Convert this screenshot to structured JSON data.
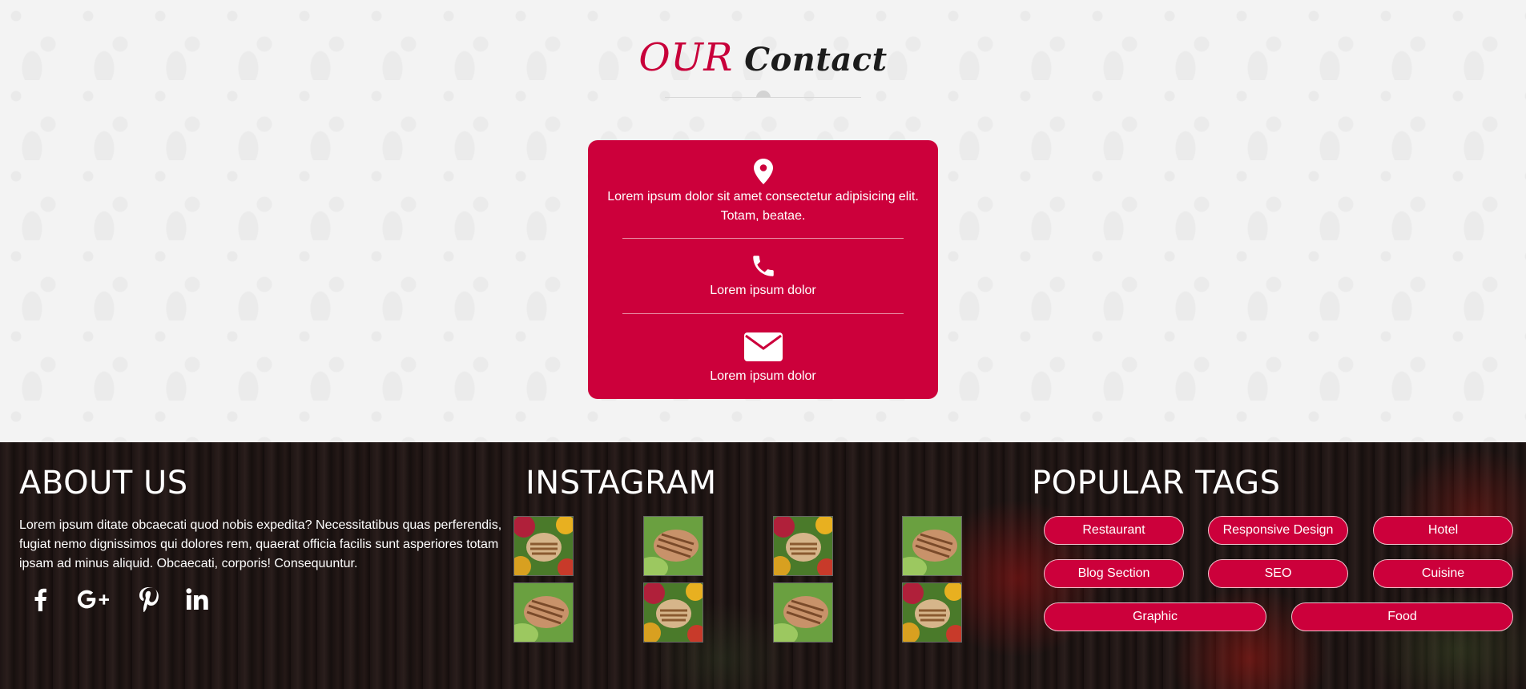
{
  "contact": {
    "title_accent": "OUR",
    "title_rest": "Contact",
    "address": "Lorem ipsum dolor sit amet consectetur adipisicing elit. Totam, beatae.",
    "phone": "Lorem ipsum dolor",
    "email": "Lorem ipsum dolor",
    "icons": [
      "map-pin-icon",
      "phone-icon",
      "envelope-icon"
    ]
  },
  "about": {
    "heading": "ABOUT US",
    "text": "Lorem ipsum ditate obcaecati quod nobis expedita? Necessitatibus quas perferendis, fugiat nemo dignissimos qui dolores rem, quaerat officia facilis sunt asperiores totam ipsam ad minus aliquid. Obcaecati, corporis! Consequuntur.",
    "social": [
      "facebook-icon",
      "google-plus-icon",
      "pinterest-icon",
      "linkedin-icon"
    ]
  },
  "instagram": {
    "heading": "INSTAGRAM",
    "images": [
      "grilled-skewer",
      "grilled-chicken-salad",
      "grilled-skewer",
      "grilled-chicken-salad",
      "grilled-chicken-salad",
      "grilled-skewer",
      "grilled-chicken-salad",
      "grilled-skewer"
    ]
  },
  "tags": {
    "heading": "POPULAR TAGS",
    "items": [
      "Restaurant",
      "Responsive Design",
      "Hotel",
      "Blog Section",
      "SEO",
      "Cuisine",
      "Graphic",
      "Food"
    ]
  },
  "colors": {
    "brand": "#cc003b",
    "footer_bg": "#1a1211",
    "page_bg": "#f3f3f3"
  }
}
